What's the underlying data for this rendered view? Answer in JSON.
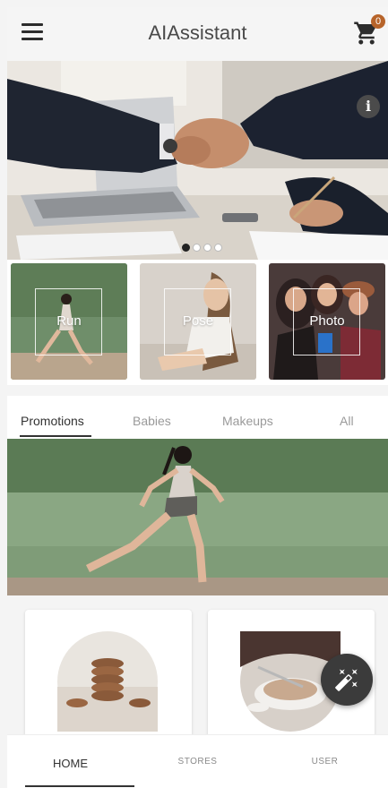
{
  "header": {
    "title": "AIAssistant",
    "cart_count": "0",
    "menu_icon": "hamburger-menu-icon",
    "cart_icon": "shopping-cart-icon"
  },
  "hero": {
    "info_icon": "info-icon",
    "info_glyph": "i",
    "slide_count": 4,
    "active_slide": 1
  },
  "categories": [
    {
      "label": "Run"
    },
    {
      "label": "Pose"
    },
    {
      "label": "Photo"
    }
  ],
  "tabs": [
    {
      "label": "Promotions",
      "active": true
    },
    {
      "label": "Babies",
      "active": false
    },
    {
      "label": "Makeups",
      "active": false
    },
    {
      "label": "All",
      "active": false
    }
  ],
  "fab": {
    "icon": "magic-wand-icon"
  },
  "bottom_nav": [
    {
      "label": "HOME",
      "active": true
    },
    {
      "label": "STORES",
      "active": false
    },
    {
      "label": "USER",
      "active": false
    }
  ],
  "colors": {
    "badge": "#b7642a",
    "fab": "#3b3b3b",
    "header_bg": "#f5f5f5"
  }
}
